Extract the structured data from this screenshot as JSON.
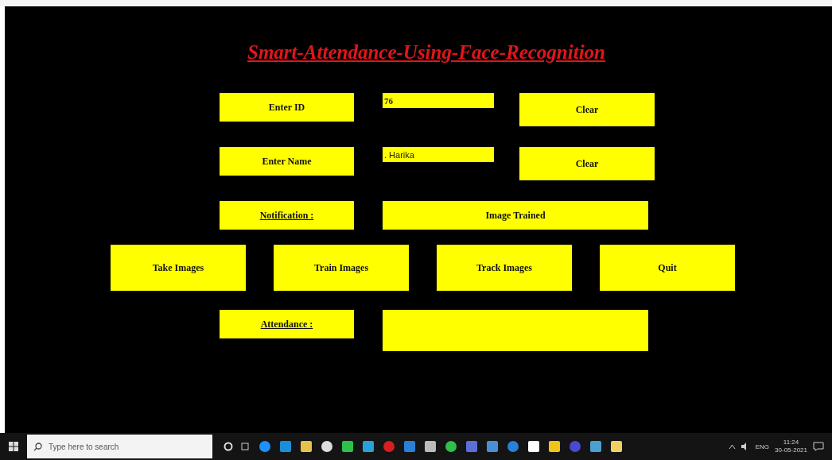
{
  "title": "Smart-Attendance-Using-Face-Recognition",
  "id_row": {
    "label": "Enter ID",
    "value": "76",
    "button": "Clear"
  },
  "name_row": {
    "label": "Enter Name",
    "value": ". Harika",
    "button": "Clear"
  },
  "notification": {
    "label": "Notification :",
    "message": "Image Trained"
  },
  "actions": [
    "Take Images",
    "Train Images",
    "Track Images",
    "Quit"
  ],
  "attendance": {
    "label": "Attendance :"
  },
  "taskbar": {
    "search_placeholder": "Type here to search",
    "language": "ENG",
    "time": "11:24",
    "date": "30-05-2021"
  }
}
